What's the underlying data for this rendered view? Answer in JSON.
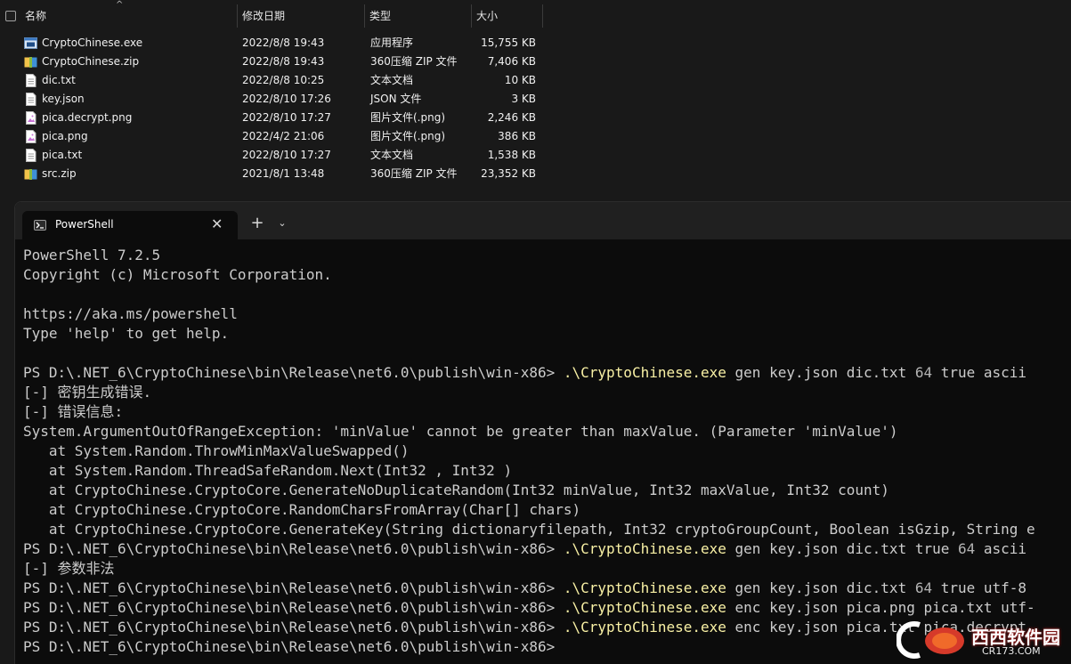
{
  "explorer": {
    "columns": {
      "name": "名称",
      "date": "修改日期",
      "type": "类型",
      "size": "大小"
    },
    "sort_indicator": "^",
    "files": [
      {
        "name": "CryptoChinese.exe",
        "date": "2022/8/8 19:43",
        "type": "应用程序",
        "size": "15,755 KB",
        "icon": "exe-icon"
      },
      {
        "name": "CryptoChinese.zip",
        "date": "2022/8/8 19:43",
        "type": "360压缩 ZIP 文件",
        "size": "7,406 KB",
        "icon": "zip-icon"
      },
      {
        "name": "dic.txt",
        "date": "2022/8/8 10:25",
        "type": "文本文档",
        "size": "10 KB",
        "icon": "text-file-icon"
      },
      {
        "name": "key.json",
        "date": "2022/8/10 17:26",
        "type": "JSON 文件",
        "size": "3 KB",
        "icon": "json-file-icon"
      },
      {
        "name": "pica.decrypt.png",
        "date": "2022/8/10 17:27",
        "type": "图片文件(.png)",
        "size": "2,246 KB",
        "icon": "image-file-icon"
      },
      {
        "name": "pica.png",
        "date": "2022/4/2 21:06",
        "type": "图片文件(.png)",
        "size": "386 KB",
        "icon": "image-file-icon"
      },
      {
        "name": "pica.txt",
        "date": "2022/8/10 17:27",
        "type": "文本文档",
        "size": "1,538 KB",
        "icon": "text-file-icon"
      },
      {
        "name": "src.zip",
        "date": "2021/8/1 13:48",
        "type": "360压缩 ZIP 文件",
        "size": "23,352 KB",
        "icon": "zip-icon"
      }
    ]
  },
  "terminal": {
    "tab_title": "PowerShell",
    "close_glyph": "✕",
    "new_tab_glyph": "+",
    "dropdown_glyph": "⌄",
    "lines": [
      {
        "t": "PowerShell 7.2.5"
      },
      {
        "t": "Copyright (c) Microsoft Corporation."
      },
      {
        "t": ""
      },
      {
        "t": "https://aka.ms/powershell"
      },
      {
        "t": "Type 'help' to get help."
      },
      {
        "t": ""
      },
      {
        "p": "PS D:\\.NET_6\\CryptoChinese\\bin\\Release\\net6.0\\publish\\win-x86> ",
        "e": ".\\CryptoChinese.exe",
        "t": " gen key.json dic.txt ",
        "n": "64",
        "r": " true ascii"
      },
      {
        "t": "[-] 密钥生成错误."
      },
      {
        "t": "[-] 错误信息:"
      },
      {
        "t": "System.ArgumentOutOfRangeException: 'minValue' cannot be greater than maxValue. (Parameter 'minValue')"
      },
      {
        "t": "   at System.Random.ThrowMinMaxValueSwapped()"
      },
      {
        "t": "   at System.Random.ThreadSafeRandom.Next(Int32 , Int32 )"
      },
      {
        "t": "   at CryptoChinese.CryptoCore.GenerateNoDuplicateRandom(Int32 minValue, Int32 maxValue, Int32 count)"
      },
      {
        "t": "   at CryptoChinese.CryptoCore.RandomCharsFromArray(Char[] chars)"
      },
      {
        "t": "   at CryptoChinese.CryptoCore.GenerateKey(String dictionaryfilepath, Int32 cryptoGroupCount, Boolean isGzip, String e"
      },
      {
        "p": "PS D:\\.NET_6\\CryptoChinese\\bin\\Release\\net6.0\\publish\\win-x86> ",
        "e": ".\\CryptoChinese.exe",
        "t": " gen key.json dic.txt true ",
        "n": "64",
        "r": " ascii"
      },
      {
        "t": "[-] 参数非法"
      },
      {
        "p": "PS D:\\.NET_6\\CryptoChinese\\bin\\Release\\net6.0\\publish\\win-x86> ",
        "e": ".\\CryptoChinese.exe",
        "t": " gen key.json dic.txt ",
        "n": "64",
        "r": " true utf-8"
      },
      {
        "p": "PS D:\\.NET_6\\CryptoChinese\\bin\\Release\\net6.0\\publish\\win-x86> ",
        "e": ".\\CryptoChinese.exe",
        "t": " enc key.json pica.png pica.txt utf-"
      },
      {
        "p": "PS D:\\.NET_6\\CryptoChinese\\bin\\Release\\net6.0\\publish\\win-x86> ",
        "e": ".\\CryptoChinese.exe",
        "t": " enc key.json pica.txt pica.decrypt."
      },
      {
        "p": "PS D:\\.NET_6\\CryptoChinese\\bin\\Release\\net6.0\\publish\\win-x86> "
      }
    ]
  },
  "watermark": {
    "text": "西西软件园",
    "sub": "CR173.COM"
  },
  "colors": {
    "exe": "#f9f1a5",
    "number": "#b4b4b4",
    "console_text": "#cccccc",
    "background": "#0c0c0c"
  }
}
